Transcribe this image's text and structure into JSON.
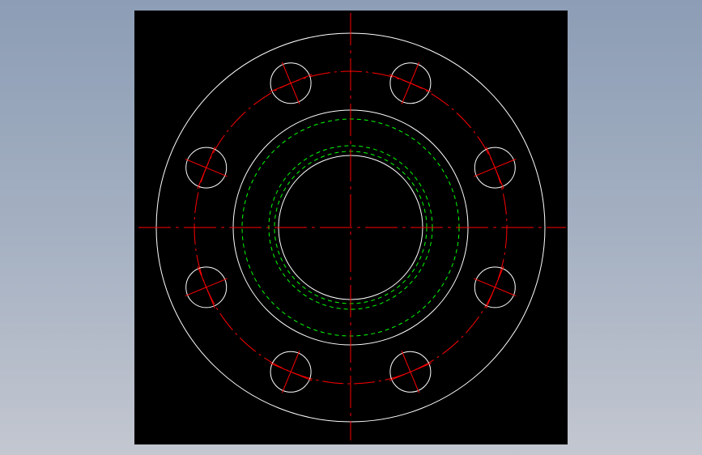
{
  "canvas": {
    "background": "#000000",
    "outer_background_top": "#8c9db5",
    "outer_background_bottom": "#c3c7d0"
  },
  "drawing": {
    "subject": "flange-top-view",
    "bolt_hole_count": 8,
    "colors": {
      "outline": "#ffffff",
      "centerline": "#ff0000",
      "hidden_line": "#00ff00"
    },
    "line_styles": {
      "outline": "solid",
      "centerline": "dash-dot",
      "hidden_line": "dashed"
    }
  }
}
